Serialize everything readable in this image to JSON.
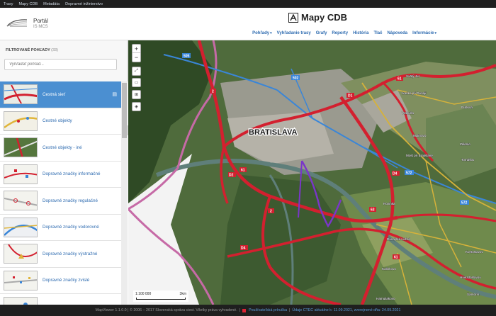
{
  "topbar": {
    "links": [
      "Trasy",
      "Mapy CDB",
      "Metadáta",
      "Dopravné inžinierstvo"
    ]
  },
  "header": {
    "logo_title": "Portál",
    "logo_subtitle": "IS MCS",
    "app_title": "Mapy CDB",
    "nav": [
      {
        "label": "Pohľady",
        "dropdown": true
      },
      {
        "label": "Vyhľadanie trasy",
        "dropdown": false
      },
      {
        "label": "Grafy",
        "dropdown": false
      },
      {
        "label": "Reporty",
        "dropdown": false
      },
      {
        "label": "História",
        "dropdown": false
      },
      {
        "label": "Tlač",
        "dropdown": false
      },
      {
        "label": "Nápoveda",
        "dropdown": false
      },
      {
        "label": "Informácie",
        "dropdown": true
      }
    ]
  },
  "sidebar": {
    "title": "FILTROVANÉ POHĽADY",
    "count": "(33)",
    "search_placeholder": "Vyhľadať pohľad...",
    "items": [
      {
        "label": "Cestná sieť",
        "active": true
      },
      {
        "label": "Cestné objekty",
        "active": false
      },
      {
        "label": "Cestné objekty - iné",
        "active": false
      },
      {
        "label": "Dopravné značky informačné",
        "active": false
      },
      {
        "label": "Dopravné značky regulačné",
        "active": false
      },
      {
        "label": "Dopravné značky vodorovné",
        "active": false
      },
      {
        "label": "Dopravné značky výstražné",
        "active": false
      },
      {
        "label": "Dopravné značky zvislé",
        "active": false
      },
      {
        "label": "",
        "active": false
      }
    ]
  },
  "map": {
    "zoom_in": "+",
    "zoom_out": "−",
    "scale_left": "1:100 000",
    "scale_right": "3km",
    "city_label": "BRATISLAVA",
    "road_numbers": [
      "505",
      "502",
      "61",
      "D1",
      "2",
      "D2",
      "61",
      "63",
      "D4",
      "572",
      "572",
      "61",
      "2",
      "D4"
    ],
    "place_labels": [
      "Svätý Jur",
      "Ivanka pri Dunaji",
      "Vrakuňa",
      "Most pri Bratislave",
      "Tomášov",
      "Malinovo",
      "Dunajská Lužná",
      "Kalinkovo",
      "Hamuliakovo",
      "Rovinka",
      "Šamorín",
      "Hviezdoslavov",
      "Dubová",
      "Zálesie",
      "Kvetoslavov"
    ],
    "colors": {
      "highway": "#d3202f",
      "road_blue": "#3a86d8",
      "road_yellow": "#d6b23a",
      "border": "#c66aa6",
      "route": "#7a36c9"
    }
  },
  "footer": {
    "copyright": "MapViewer 1.1.0.0 | © 2006 – 2017 Slovenská správa ciest. Všetky práva vyhradené.",
    "manual": "Používateľská príručka",
    "data_status": "Údaje CTEC aktuálne k: 11.09.2021, zverejnené dňa: 24.09.2021"
  }
}
